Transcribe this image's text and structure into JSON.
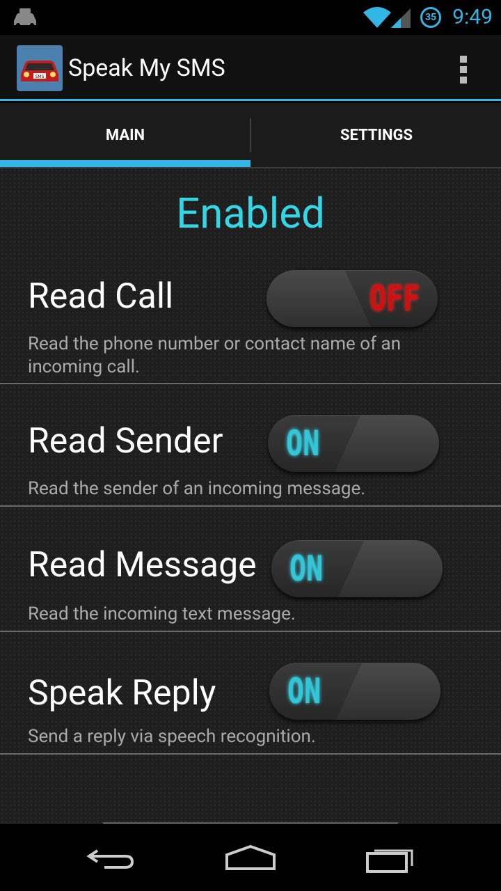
{
  "status_bar": {
    "time": "9:49",
    "battery_level": "35",
    "icons": [
      "car-sms-notification-icon",
      "wifi-icon",
      "signal-icon",
      "battery-icon"
    ]
  },
  "action_bar": {
    "title": "Speak My SMS",
    "app_icon": "car-sms-app-icon",
    "overflow_icon": "overflow-menu-icon"
  },
  "tabs": [
    {
      "label": "MAIN",
      "selected": true
    },
    {
      "label": "SETTINGS",
      "selected": false
    }
  ],
  "main": {
    "status_heading": "Enabled",
    "preferences": [
      {
        "title": "Read Call",
        "description": "Read the phone number or contact name of an incoming call.",
        "toggle_label": "OFF",
        "state": "off"
      },
      {
        "title": "Read Sender",
        "description": "Read the sender of an incoming message.",
        "toggle_label": "ON",
        "state": "on"
      },
      {
        "title": "Read Message",
        "description": "Read the incoming text message.",
        "toggle_label": "ON",
        "state": "on"
      },
      {
        "title": "Speak Reply",
        "description": "Send a reply via speech recognition.",
        "toggle_label": "ON",
        "state": "on"
      }
    ]
  },
  "nav_bar": {
    "buttons": [
      "back-icon",
      "home-icon",
      "recents-icon"
    ]
  },
  "colors": {
    "accent": "#33b5e5",
    "enabled_text": "#33d6e5",
    "toggle_on": "#34c5d6",
    "toggle_off": "#d11010"
  }
}
